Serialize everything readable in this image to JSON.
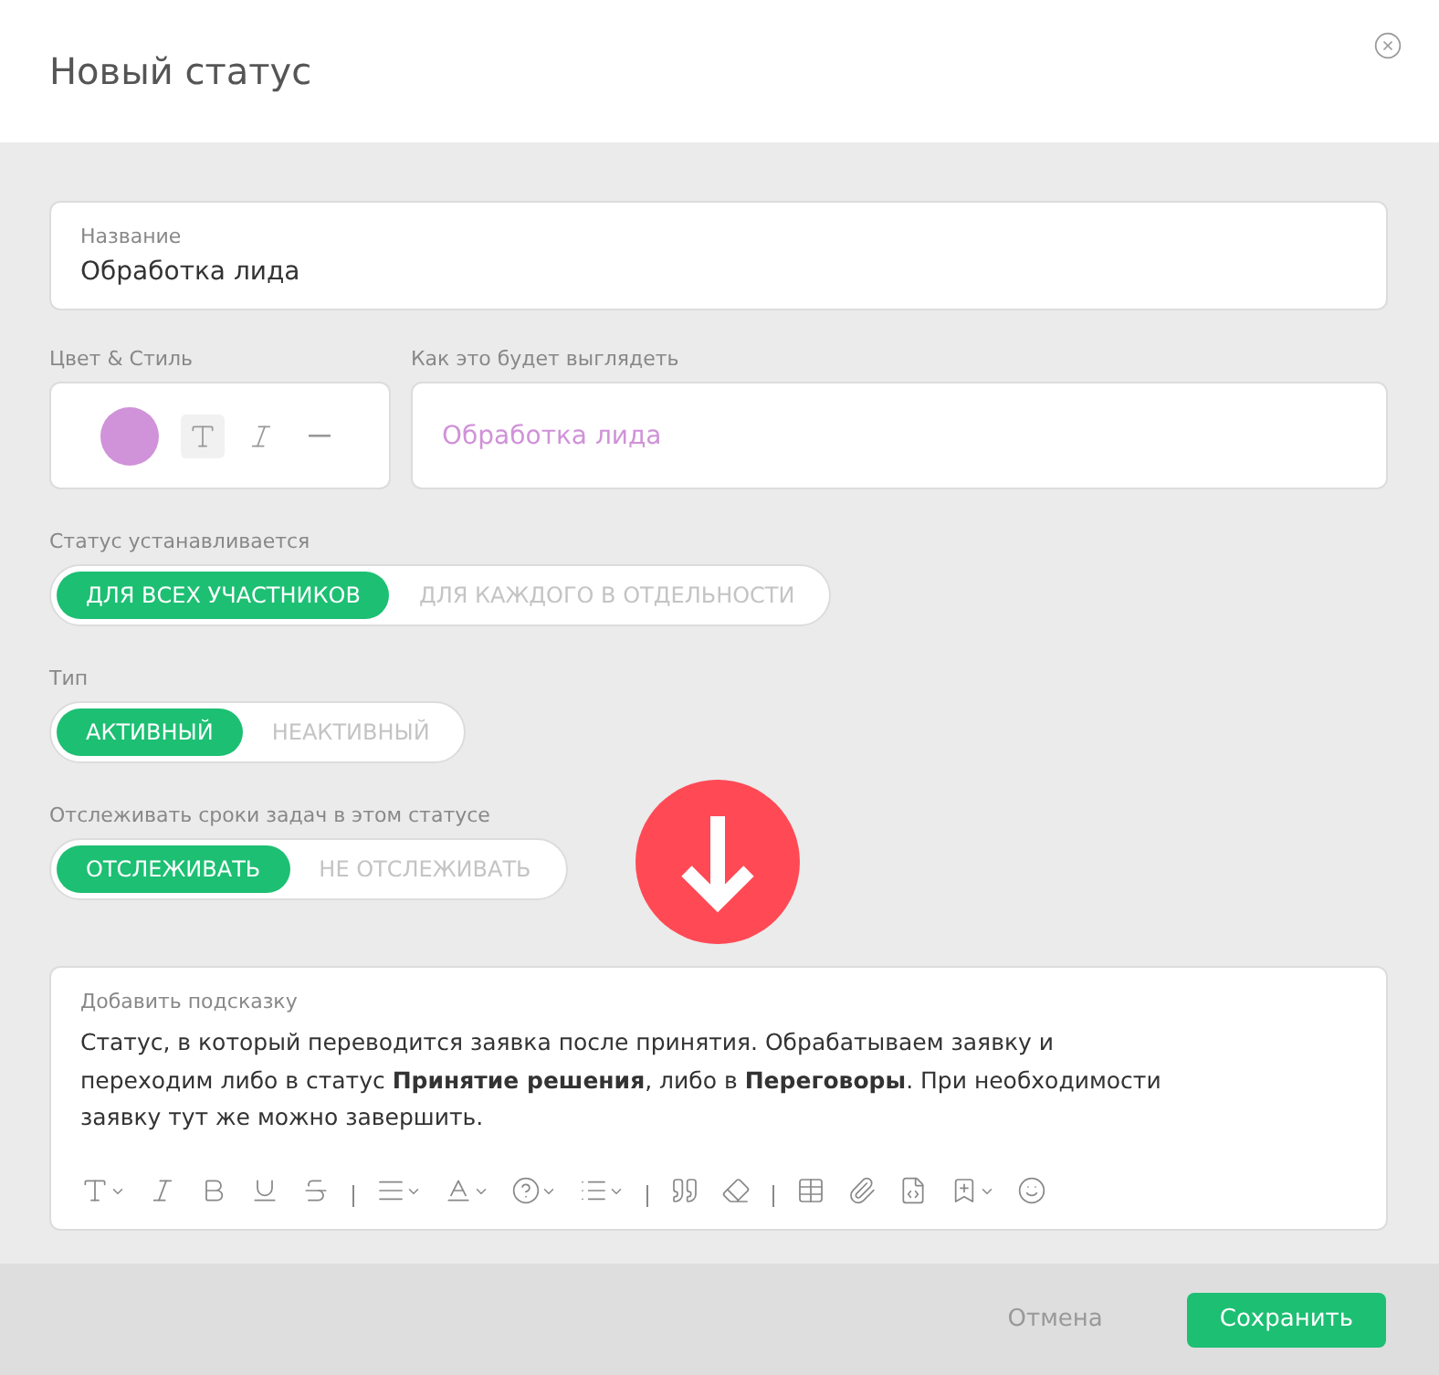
{
  "dialog": {
    "title": "Новый статус"
  },
  "name_field": {
    "label": "Название",
    "value": "Обработка лида"
  },
  "style": {
    "label": "Цвет & Стиль",
    "color": "#d092d8",
    "options": [
      {
        "kind": "normal",
        "selected": true
      },
      {
        "kind": "italic",
        "selected": false
      },
      {
        "kind": "strike",
        "selected": false
      }
    ]
  },
  "preview": {
    "label": "Как это будет выглядеть",
    "text": "Обработка лида"
  },
  "toggles": [
    {
      "label": "Статус устанавливается",
      "options": [
        {
          "label": "ДЛЯ ВСЕХ УЧАСТНИКОВ",
          "selected": true
        },
        {
          "label": "ДЛЯ КАЖДОГО В ОТДЕЛЬНОСТИ",
          "selected": false
        }
      ]
    },
    {
      "label": "Тип",
      "options": [
        {
          "label": "АКТИВНЫЙ",
          "selected": true
        },
        {
          "label": "НЕАКТИВНЫЙ",
          "selected": false
        }
      ]
    },
    {
      "label": "Отслеживать сроки задач в этом статусе",
      "options": [
        {
          "label": "ОТСЛЕЖИВАТЬ",
          "selected": true
        },
        {
          "label": "НЕ ОТСЛЕЖИВАТЬ",
          "selected": false
        }
      ]
    }
  ],
  "hint": {
    "label": "Добавить подсказку",
    "lines": [
      "Статус, в который переводится заявка после принятия. Обрабатываем заявку и",
      "переходим либо в статус **Принятие решения**, либо в **Переговоры**. При необходимости",
      "заявку тут же можно завершить."
    ]
  },
  "footer": {
    "buttons": [
      {
        "label": "Отмена",
        "kind": "secondary"
      },
      {
        "label": "Сохранить",
        "kind": "primary"
      }
    ]
  }
}
